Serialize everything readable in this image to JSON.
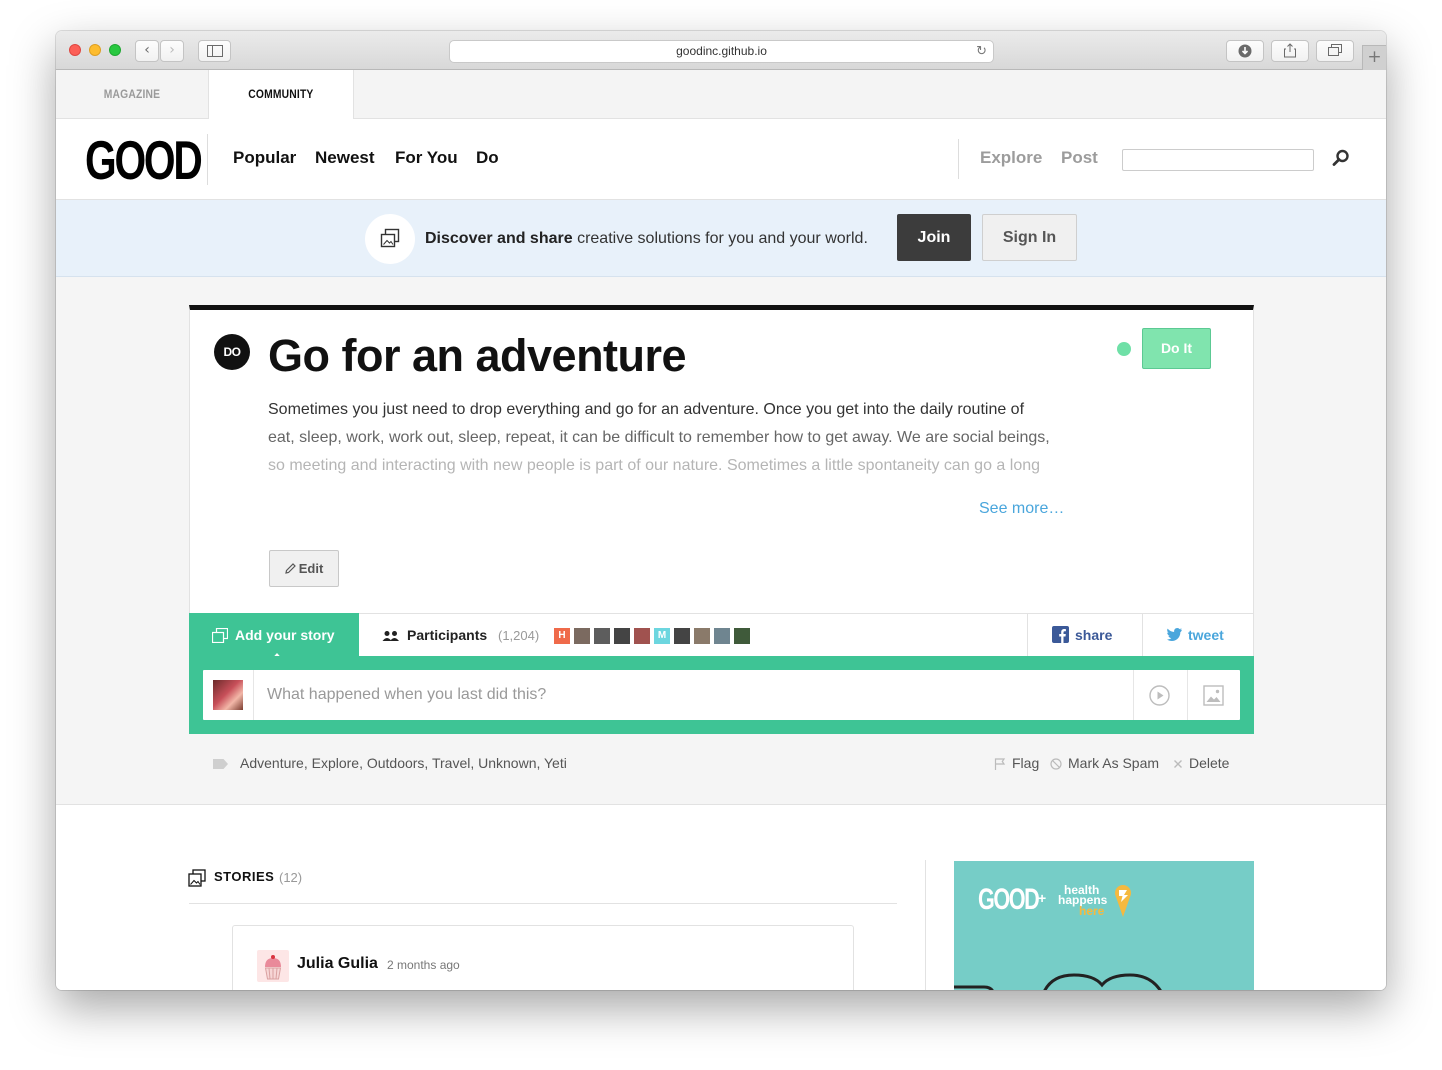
{
  "browser": {
    "url": "goodinc.github.io",
    "back_glyph": "‹",
    "forward_glyph": "›",
    "new_tab_glyph": "+"
  },
  "site_tabs": {
    "magazine": "MAGAZINE",
    "community": "COMMUNITY"
  },
  "header": {
    "logo": "GOOD",
    "nav": [
      "Popular",
      "Newest",
      "For You",
      "Do"
    ],
    "right_nav": [
      "Explore",
      "Post"
    ],
    "search_placeholder": ""
  },
  "banner": {
    "bold_text": "Discover and share",
    "text": " creative solutions for you and your world.",
    "join_label": "Join",
    "signin_label": "Sign In"
  },
  "card": {
    "badge": "DO",
    "title": "Go for an adventure",
    "status_color": "#6fe0a7",
    "do_it_label": "Do It",
    "description_lines": [
      "Sometimes you just need to drop everything and go for an adventure. Once you get into the daily routine of",
      "eat, sleep, work, work out, sleep, repeat, it can be difficult to remember how to get away. We are social beings,",
      "so meeting and interacting with new people is part of our nature. Sometimes a little spontaneity can go a long"
    ],
    "see_more": "See more…",
    "edit_label": "Edit"
  },
  "story_bar": {
    "add_story_label": "Add your story",
    "participants_label": "Participants",
    "participants_count": "(1,204)",
    "avatar_letters": [
      "H",
      "",
      "",
      "",
      "",
      "M",
      "",
      "",
      "",
      ""
    ],
    "avatar_colors": [
      "#ef6a4a",
      "#7b6a60",
      "#5d5d5d",
      "#444",
      "#a0524f",
      "#6cd6df",
      "#444",
      "#8a7a6a",
      "#6f8590",
      "#3f5a3a"
    ],
    "share_label": "share",
    "tweet_label": "tweet",
    "accent_color": "#3ec495"
  },
  "story_input": {
    "placeholder": "What happened when you last did this?"
  },
  "tags": {
    "text": "Adventure, Explore, Outdoors, Travel, Unknown, Yeti"
  },
  "actions": {
    "flag": "Flag",
    "spam": "Mark As Spam",
    "delete": "Delete"
  },
  "stories": {
    "title": "STORIES",
    "count": "(12)",
    "items": [
      {
        "author": "Julia Gulia",
        "time": "2 months ago"
      }
    ]
  },
  "ad": {
    "brand": "GOOD",
    "plus": "+",
    "line1": "health",
    "line2": "happens",
    "line3": "here"
  }
}
